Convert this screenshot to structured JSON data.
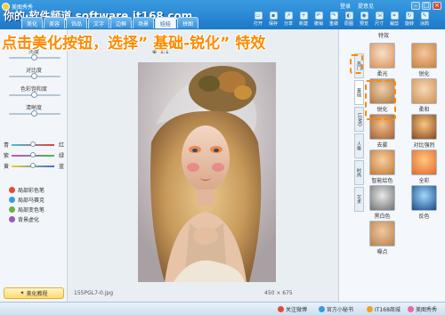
{
  "window": {
    "app_name": "美图秀秀",
    "watermark": "你的·软件频道 software.it168.com",
    "tabs": [
      "美化",
      "美容",
      "饰品",
      "文字",
      "边框",
      "场景",
      "娃娃",
      "拼图"
    ],
    "active_tab": "美化",
    "user_links": [
      "登录",
      "提意见"
    ],
    "toolbar": [
      "打开",
      "保存",
      "分享",
      "新建",
      "撤销",
      "重做",
      "原图",
      "预览",
      "尺寸",
      "裁剪",
      "旋转",
      "涂鸦"
    ]
  },
  "banner": "点击美化按钮，选择” 基础-锐化” 特效",
  "left_panel": {
    "sliders": [
      {
        "label": "亮度",
        "level": 0.5
      },
      {
        "label": "对比度",
        "level": 0.5
      },
      {
        "label": "色彩饱和度",
        "level": 0.5
      },
      {
        "label": "清晰度",
        "level": 0.5
      }
    ],
    "color_sliders": [
      {
        "left": "青",
        "right": "红"
      },
      {
        "left": "紫",
        "right": "绿"
      },
      {
        "left": "黄",
        "right": "蓝"
      }
    ],
    "effects": [
      {
        "label": "局部彩色笔",
        "color": "#e04a3a"
      },
      {
        "label": "局部马赛克",
        "color": "#3a9be0"
      },
      {
        "label": "局部变色笔",
        "color": "#6ab04c"
      },
      {
        "label": "背景虚化",
        "color": "#9b59b6"
      }
    ],
    "beautify_button": "美化教程"
  },
  "canvas": {
    "zoom_label": "1:1",
    "filename": "155PGL7-0.jpg",
    "dimensions": "450 × 675"
  },
  "right_panel": {
    "title": "特效",
    "side_tabs": [
      "热门",
      "基础",
      "LOMO",
      "人像",
      "时尚",
      "艺术"
    ],
    "active_side_tab": "基础",
    "thumbnails": [
      "柔光",
      "锐化",
      "锐化",
      "柔和",
      "去雾",
      "对比强烈",
      "智能绘色",
      "全彩",
      "黑白色",
      "反色",
      "噪点",
      ""
    ]
  },
  "bottom_bar": [
    "关注微博",
    "官方小秘书",
    "IT168商城",
    "美图秀秀"
  ]
}
